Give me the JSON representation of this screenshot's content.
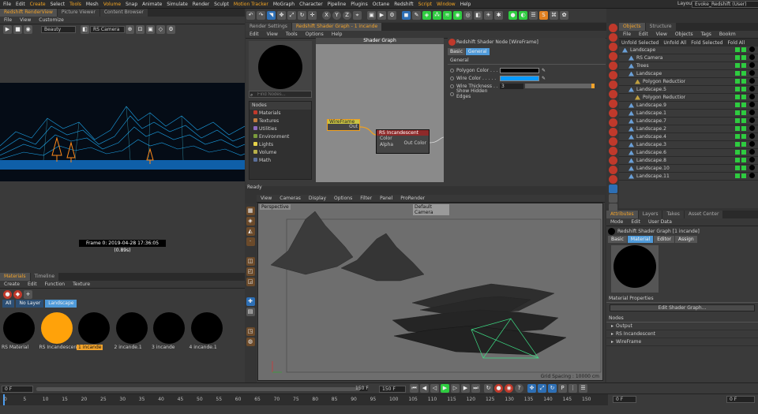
{
  "menu": {
    "items": [
      "File",
      "Edit",
      "Create",
      "Select",
      "Tools",
      "Mesh",
      "Volume",
      "Snap",
      "Animate",
      "Simulate",
      "Render",
      "Sculpt",
      "Motion Tracker",
      "MoGraph",
      "Character",
      "Pipeline",
      "Plugins",
      "Octane",
      "Redshift",
      "Script",
      "Window",
      "Help"
    ],
    "layout_label": "Layout:",
    "layout_value": "Evoke_Redshift (User)"
  },
  "renderview": {
    "tabs": [
      "Redshift RenderView",
      "Picture Viewer",
      "Content Browser"
    ],
    "menu": [
      "File",
      "View",
      "Customize"
    ],
    "aov": "Beauty",
    "camera": "RS Camera",
    "frame_info": "Frame  0:  2019-04-28  17:36:05  (0.89s)"
  },
  "materials": {
    "tabs": [
      "Materials",
      "Timeline"
    ],
    "menu": [
      "Create",
      "Edit",
      "Function",
      "Texture"
    ],
    "layers": [
      "All",
      "No Layer",
      "Landscape"
    ],
    "items": [
      {
        "label": "RS Material",
        "color": "#000000"
      },
      {
        "label": "RS Incandescent",
        "color": "#ffa20a"
      },
      {
        "label": "1 incande",
        "color": "#000000"
      },
      {
        "label": "2 incande.1",
        "color": "#000000"
      },
      {
        "label": "3 incande",
        "color": "#000000"
      },
      {
        "label": "4 incande.1",
        "color": "#000000"
      }
    ]
  },
  "shader": {
    "tabs": [
      "Render Settings",
      "Redshift Shader Graph - 1 incande"
    ],
    "menu": [
      "Edit",
      "View",
      "Tools",
      "Options",
      "Help"
    ],
    "title": "Shader Graph",
    "find_placeholder": "Find Nodes...",
    "nodes_header": "Nodes",
    "categories": [
      {
        "label": "Materials",
        "color": "#c0392b"
      },
      {
        "label": "Textures",
        "color": "#c27c3e"
      },
      {
        "label": "Utilities",
        "color": "#8e6bbf"
      },
      {
        "label": "Environment",
        "color": "#7a9b3c"
      },
      {
        "label": "Lights",
        "color": "#e6d34a"
      },
      {
        "label": "Volume",
        "color": "#b8b04a"
      },
      {
        "label": "Math",
        "color": "#5a6f9b"
      }
    ],
    "wire_node": {
      "title": "WireFrame",
      "port": "Out"
    },
    "rs_node": {
      "title": "RS Incandescent",
      "ports_in": [
        "Color",
        "Alpha"
      ],
      "port_out": "Out Color"
    },
    "status": "Ready"
  },
  "props": {
    "title": "Redshift Shader Node [WireFrame]",
    "tabs": [
      "Basic",
      "General"
    ],
    "section": "General",
    "fields": [
      {
        "label": "Polygon Color . . .",
        "color": "#000000"
      },
      {
        "label": "Wire Color . . . . .",
        "color": "#0a9bff"
      },
      {
        "label": "Wire Thickness . .",
        "value": "3"
      },
      {
        "label": "Show Hidden Edges",
        "value": "checkbox"
      }
    ]
  },
  "viewport": {
    "menu": [
      "View",
      "Cameras",
      "Display",
      "Options",
      "Filter",
      "Panel",
      "ProRender"
    ],
    "name": "Perspective",
    "camera": "Default Camera",
    "grid": "Grid Spacing : 10000 cm"
  },
  "objects": {
    "tabs": [
      "Objects",
      "Structure"
    ],
    "menu": [
      "File",
      "Edit",
      "View",
      "Objects",
      "Tags",
      "Bookm"
    ],
    "actions": [
      "Unfold Selected",
      "Unfold All",
      "Fold Selected",
      "Fold All"
    ],
    "rows": [
      {
        "name": "Landscape",
        "indent": 0
      },
      {
        "name": "RS Camera",
        "indent": 1
      },
      {
        "name": "Trees",
        "indent": 1
      },
      {
        "name": "Landscape",
        "indent": 1
      },
      {
        "name": "Polygon Reduction",
        "indent": 2
      },
      {
        "name": "Landscape.5",
        "indent": 1
      },
      {
        "name": "Polygon Reduction",
        "indent": 2
      },
      {
        "name": "Landscape.9",
        "indent": 1
      },
      {
        "name": "Landscape.1",
        "indent": 1
      },
      {
        "name": "Landscape.7",
        "indent": 1
      },
      {
        "name": "Landscape.2",
        "indent": 1
      },
      {
        "name": "Landscape.4",
        "indent": 1
      },
      {
        "name": "Landscape.3",
        "indent": 1
      },
      {
        "name": "Landscape.6",
        "indent": 1
      },
      {
        "name": "Landscape.8",
        "indent": 1
      },
      {
        "name": "Landscape.10",
        "indent": 1
      },
      {
        "name": "Landscape.11",
        "indent": 1
      }
    ]
  },
  "attributes": {
    "tabs": [
      "Attributes",
      "Layers",
      "Takes",
      "Asset Center"
    ],
    "menu": [
      "Mode",
      "Edit",
      "User Data"
    ],
    "title": "Redshift Shader Graph [1 incande]",
    "subtabs": [
      "Basic",
      "Material",
      "Editor",
      "Assign"
    ],
    "section": "Material Properties",
    "button": "Edit Shader Graph...",
    "nodes_header": "Nodes",
    "nodes": [
      "Output",
      "RS Incandescent",
      "WireFrame"
    ]
  },
  "timeline": {
    "start": "0 F",
    "end_a": "150 F",
    "end_b": "150 F",
    "current": "0 F",
    "current_right": "0 F",
    "ticks": [
      "0",
      "5",
      "10",
      "15",
      "20",
      "25",
      "30",
      "35",
      "40",
      "45",
      "50",
      "55",
      "60",
      "65",
      "70",
      "75",
      "80",
      "85",
      "90",
      "95",
      "100",
      "105",
      "110",
      "115",
      "120",
      "125",
      "130",
      "135",
      "140",
      "145",
      "150"
    ]
  }
}
